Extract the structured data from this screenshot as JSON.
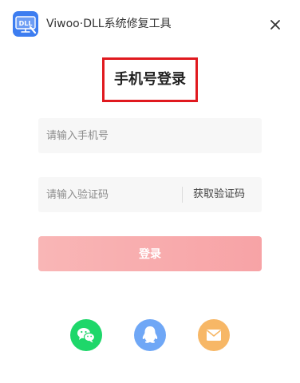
{
  "titlebar": {
    "logo_text": "DLL",
    "title": "Viwoo·DLL系统修复工具",
    "close_icon": "close-icon"
  },
  "login": {
    "heading": "手机号登录",
    "phone_placeholder": "请输入手机号",
    "code_placeholder": "请输入验证码",
    "get_code_label": "获取验证码",
    "submit_label": "登录"
  },
  "social": {
    "icons": [
      "wechat-icon",
      "qq-icon",
      "email-icon"
    ]
  },
  "colors": {
    "brand": "#3d7df0",
    "highlight_border": "#e0191f",
    "login_button": "#f7a3a6",
    "wechat": "#1ed76a",
    "qq": "#6fa7f6",
    "email": "#f7b766"
  }
}
